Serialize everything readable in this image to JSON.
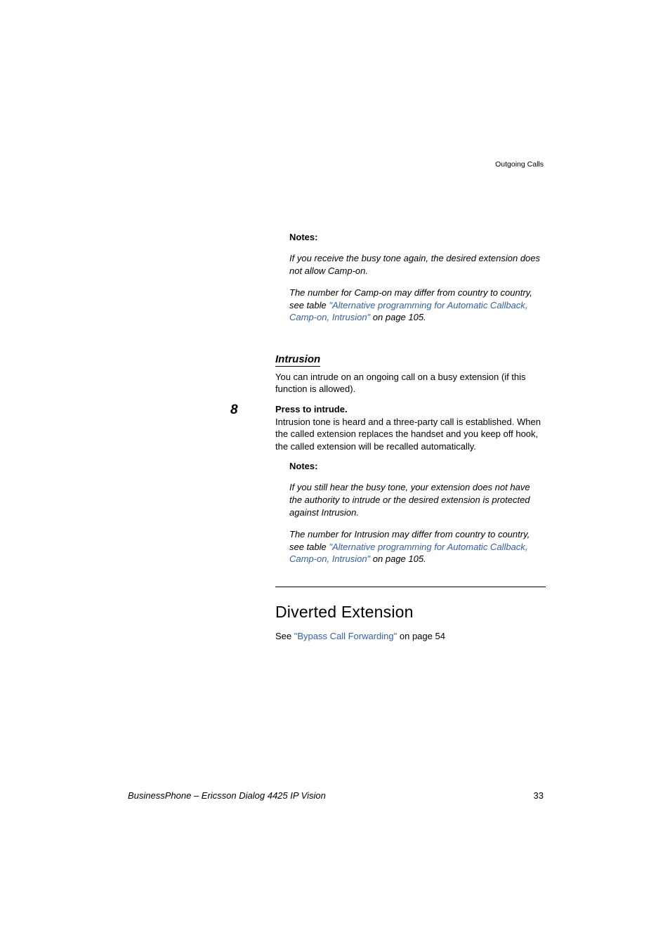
{
  "header": {
    "section": "Outgoing Calls"
  },
  "notes1": {
    "label": "Notes:",
    "p1": "If you receive the busy tone again, the desired extension does not allow Camp-on.",
    "p2_pre": "The number for Camp-on may differ from country to country, see table ",
    "p2_link": "\"Alternative programming for Automatic Callback, Camp-on, Intrusion\"",
    "p2_post": " on page 105."
  },
  "intrusion": {
    "heading": "Intrusion",
    "intro": "You can intrude on an ongoing call on a busy extension (if this function is allowed).",
    "step_number": "8",
    "step_title": "Press to intrude.",
    "step_body": "Intrusion tone is heard and a three-party call is established. When the called extension replaces the handset and you keep off hook, the called extension will be recalled automatically."
  },
  "notes2": {
    "label": "Notes:",
    "p1": "If you still hear the busy tone, your extension does not have the authority to intrude or the desired extension is protected against Intrusion.",
    "p2_pre": "The number for Intrusion may differ from country to country, see table ",
    "p2_link": "\"Alternative programming for Automatic Callback, Camp-on, Intrusion\"",
    "p2_post": " on page 105."
  },
  "diverted": {
    "heading": "Diverted Extension",
    "see_pre": "See ",
    "see_link": "\"Bypass Call Forwarding\"",
    "see_post": " on page 54"
  },
  "footer": {
    "left": "BusinessPhone – Ericsson Dialog 4425 IP Vision",
    "page": "33"
  }
}
